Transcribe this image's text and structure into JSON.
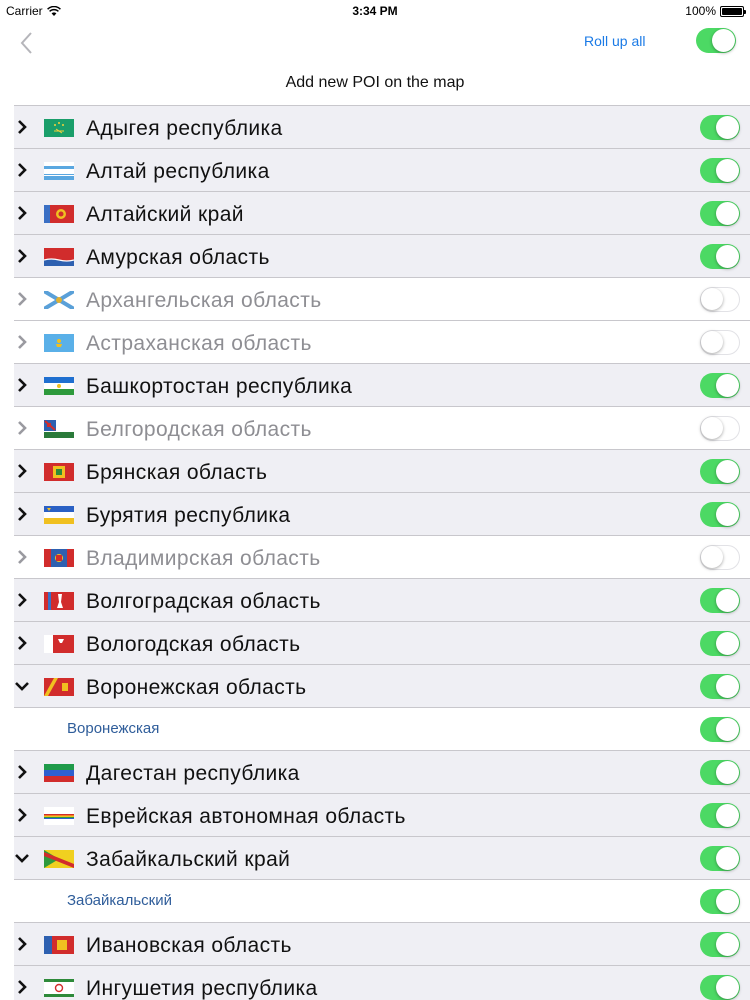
{
  "status_bar": {
    "carrier": "Carrier",
    "time": "3:34 PM",
    "battery_percent": "100%",
    "battery_level": 1.0
  },
  "nav": {
    "back_icon": "chevron-left-icon",
    "rollup_label": "Roll up all",
    "all_toggle_on": true
  },
  "header": {
    "title": "Add new POI on the map"
  },
  "colors": {
    "toggle_on": "#4cd964",
    "link": "#1a7ae6",
    "sub_label": "#2f5d9a",
    "row_bg_on": "#efeff4",
    "row_bg_off": "#ffffff"
  },
  "regions": [
    {
      "label": "Адыгея республика",
      "enabled": true,
      "expanded": false,
      "flag": "adygea-flag"
    },
    {
      "label": "Алтай республика",
      "enabled": true,
      "expanded": false,
      "flag": "altai-republic-flag"
    },
    {
      "label": "Алтайский край",
      "enabled": true,
      "expanded": false,
      "flag": "altai-krai-flag"
    },
    {
      "label": "Амурская область",
      "enabled": true,
      "expanded": false,
      "flag": "amur-flag"
    },
    {
      "label": "Архангельская область",
      "enabled": false,
      "expanded": false,
      "flag": "arkhangelsk-flag"
    },
    {
      "label": "Астраханская область",
      "enabled": false,
      "expanded": false,
      "flag": "astrakhan-flag"
    },
    {
      "label": "Башкортостан республика",
      "enabled": true,
      "expanded": false,
      "flag": "bashkortostan-flag"
    },
    {
      "label": "Белгородская область",
      "enabled": false,
      "expanded": false,
      "flag": "belgorod-flag"
    },
    {
      "label": "Брянская область",
      "enabled": true,
      "expanded": false,
      "flag": "bryansk-flag"
    },
    {
      "label": "Бурятия республика",
      "enabled": true,
      "expanded": false,
      "flag": "buryatia-flag"
    },
    {
      "label": "Владимирская область",
      "enabled": false,
      "expanded": false,
      "flag": "vladimir-flag"
    },
    {
      "label": "Волгоградская область",
      "enabled": true,
      "expanded": false,
      "flag": "volgograd-flag"
    },
    {
      "label": "Вологодская область",
      "enabled": true,
      "expanded": false,
      "flag": "vologda-flag"
    },
    {
      "label": "Воронежская область",
      "enabled": true,
      "expanded": true,
      "flag": "voronezh-flag"
    },
    {
      "sub": true,
      "label": "Воронежская",
      "enabled": true
    },
    {
      "label": "Дагестан республика",
      "enabled": true,
      "expanded": false,
      "flag": "dagestan-flag"
    },
    {
      "label": "Еврейская автономная область",
      "enabled": true,
      "expanded": false,
      "flag": "jewish-ao-flag"
    },
    {
      "label": "Забайкальский край",
      "enabled": true,
      "expanded": true,
      "flag": "zabaykalsky-flag"
    },
    {
      "sub": true,
      "label": "Забайкальский",
      "enabled": true
    },
    {
      "label": "Ивановская область",
      "enabled": true,
      "expanded": false,
      "flag": "ivanovo-flag"
    },
    {
      "label": "Ингушетия республика",
      "enabled": true,
      "expanded": false,
      "flag": "ingushetia-flag"
    }
  ]
}
